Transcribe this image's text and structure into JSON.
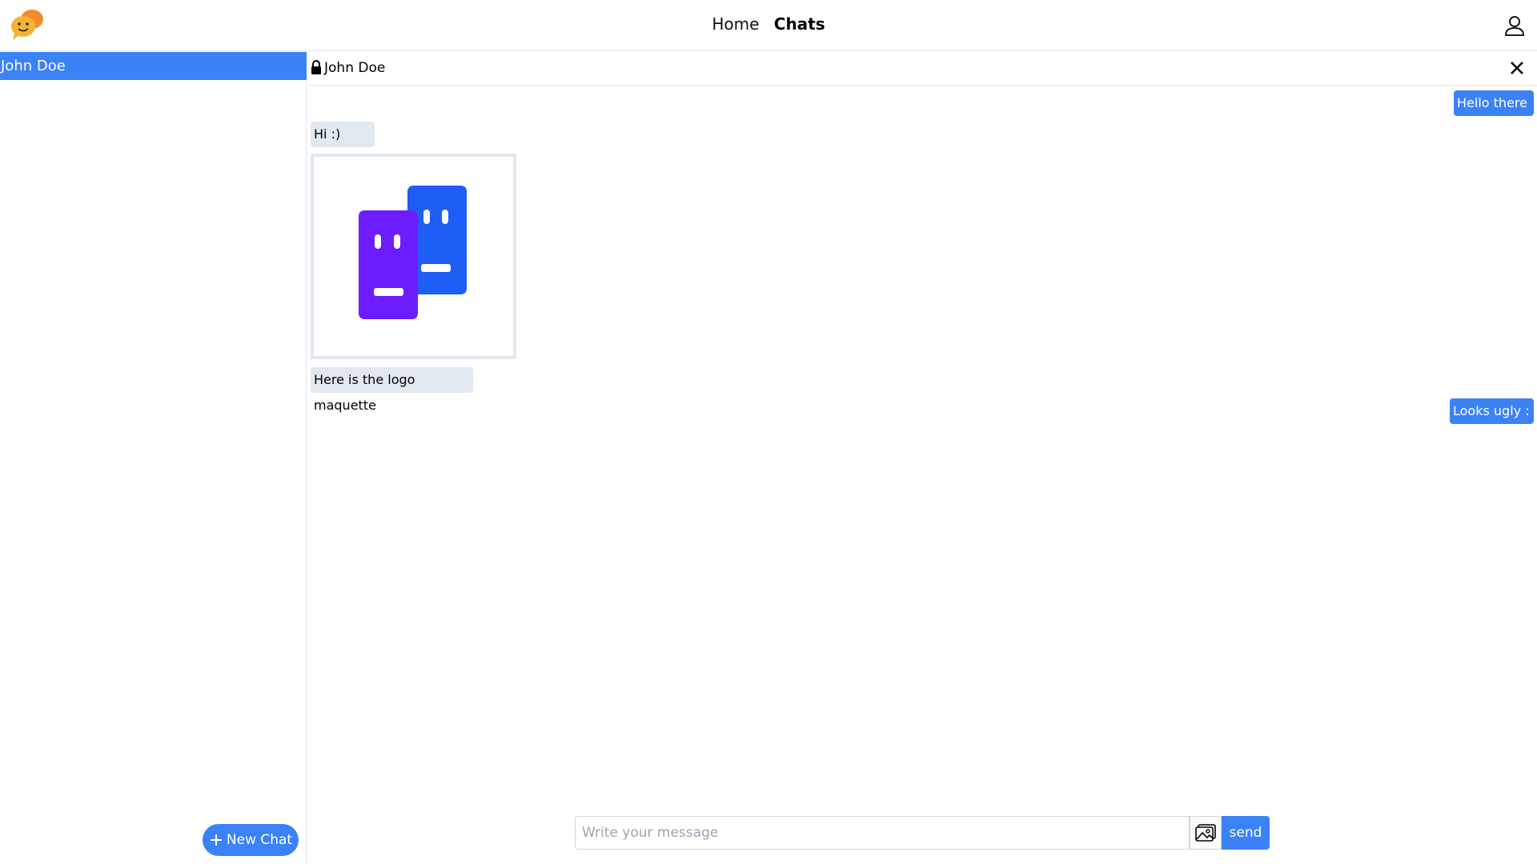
{
  "nav": {
    "home": "Home",
    "chats": "Chats"
  },
  "icons": {
    "logo": "chat-bubbles-logo-icon",
    "user": "user-icon",
    "lock": "lock-icon",
    "close": "close-icon",
    "image": "image-icon",
    "plus": "plus-icon"
  },
  "colors": {
    "accent": "#3b82f6",
    "incoming_bubble": "#e2e8f0",
    "logo_purple": "#6d1cff",
    "logo_blue": "#1f5ef5",
    "logo_orange": "#f5a623"
  },
  "sidebar": {
    "chats": [
      {
        "label": "John Doe"
      }
    ],
    "new_chat_label": "New Chat"
  },
  "chat": {
    "title": "John Doe",
    "messages": [
      {
        "direction": "out",
        "text": "Hello there !"
      },
      {
        "direction": "in",
        "text": "Hi :)"
      },
      {
        "direction": "in",
        "type": "image",
        "alt": "logo maquette"
      },
      {
        "direction": "in",
        "text": "Here is the logo maquette"
      },
      {
        "direction": "out",
        "text": "Looks ugly :("
      }
    ]
  },
  "composer": {
    "placeholder": "Write your message",
    "send_label": "send"
  }
}
